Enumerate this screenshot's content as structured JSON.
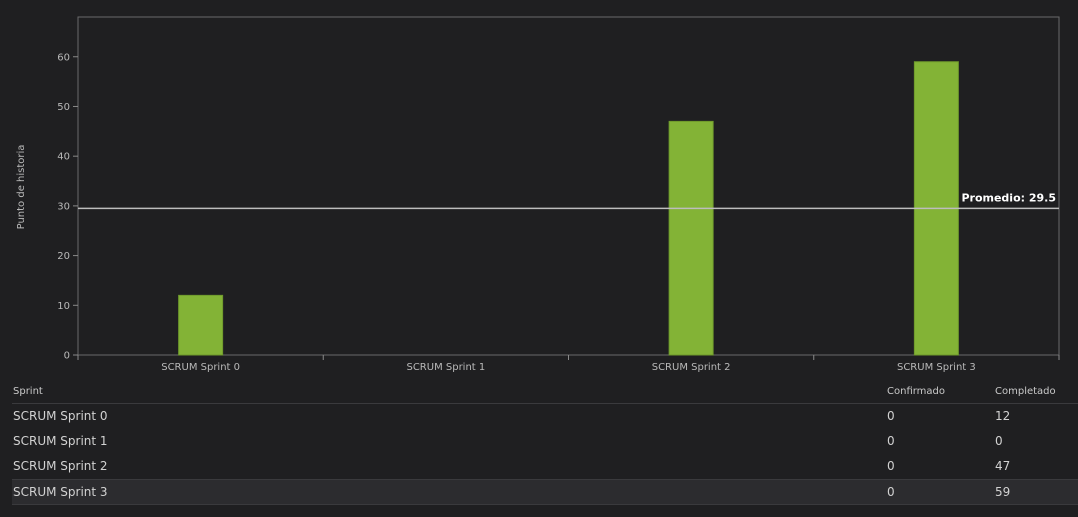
{
  "chart_data": {
    "type": "bar",
    "categories": [
      "SCRUM Sprint 0",
      "SCRUM Sprint 1",
      "SCRUM Sprint 2",
      "SCRUM Sprint 3"
    ],
    "series": [
      {
        "values": [
          12,
          0,
          47,
          59
        ],
        "color": "#83b336"
      }
    ],
    "ylabel": "Punto de historia",
    "ylim": [
      0,
      68
    ],
    "yticks": [
      0,
      10,
      20,
      30,
      40,
      50,
      60
    ],
    "average": {
      "label": "Promedio: 29.5",
      "value": 29.5
    },
    "grid": false
  },
  "table": {
    "headers": {
      "sprint": "Sprint",
      "confirmed": "Confirmado",
      "completed": "Completado"
    },
    "rows": [
      {
        "sprint": "SCRUM Sprint 0",
        "confirmed": "0",
        "completed": "12"
      },
      {
        "sprint": "SCRUM Sprint 1",
        "confirmed": "0",
        "completed": "0"
      },
      {
        "sprint": "SCRUM Sprint 2",
        "confirmed": "0",
        "completed": "47"
      },
      {
        "sprint": "SCRUM Sprint 3",
        "confirmed": "0",
        "completed": "59",
        "selected": true
      }
    ]
  },
  "colors": {
    "background": "#1f1f21",
    "bar": "#83b336",
    "average_line": "#bdbdbd",
    "axis": "#8a8a8a"
  }
}
